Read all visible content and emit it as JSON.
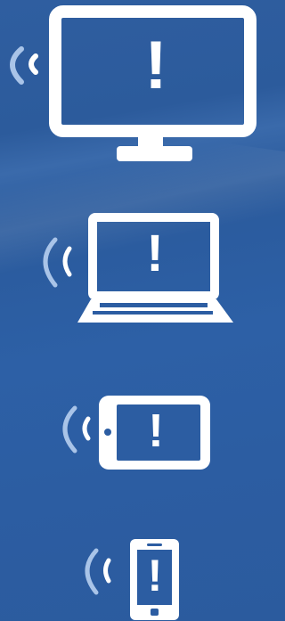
{
  "colors": {
    "background": "#2c5da2",
    "icon": "#ffffff",
    "signal": "#a9c4e8"
  },
  "devices": [
    {
      "name": "desktop-monitor",
      "alert": "!"
    },
    {
      "name": "laptop",
      "alert": "!"
    },
    {
      "name": "tablet",
      "alert": "!"
    },
    {
      "name": "smartphone",
      "alert": "!"
    }
  ]
}
